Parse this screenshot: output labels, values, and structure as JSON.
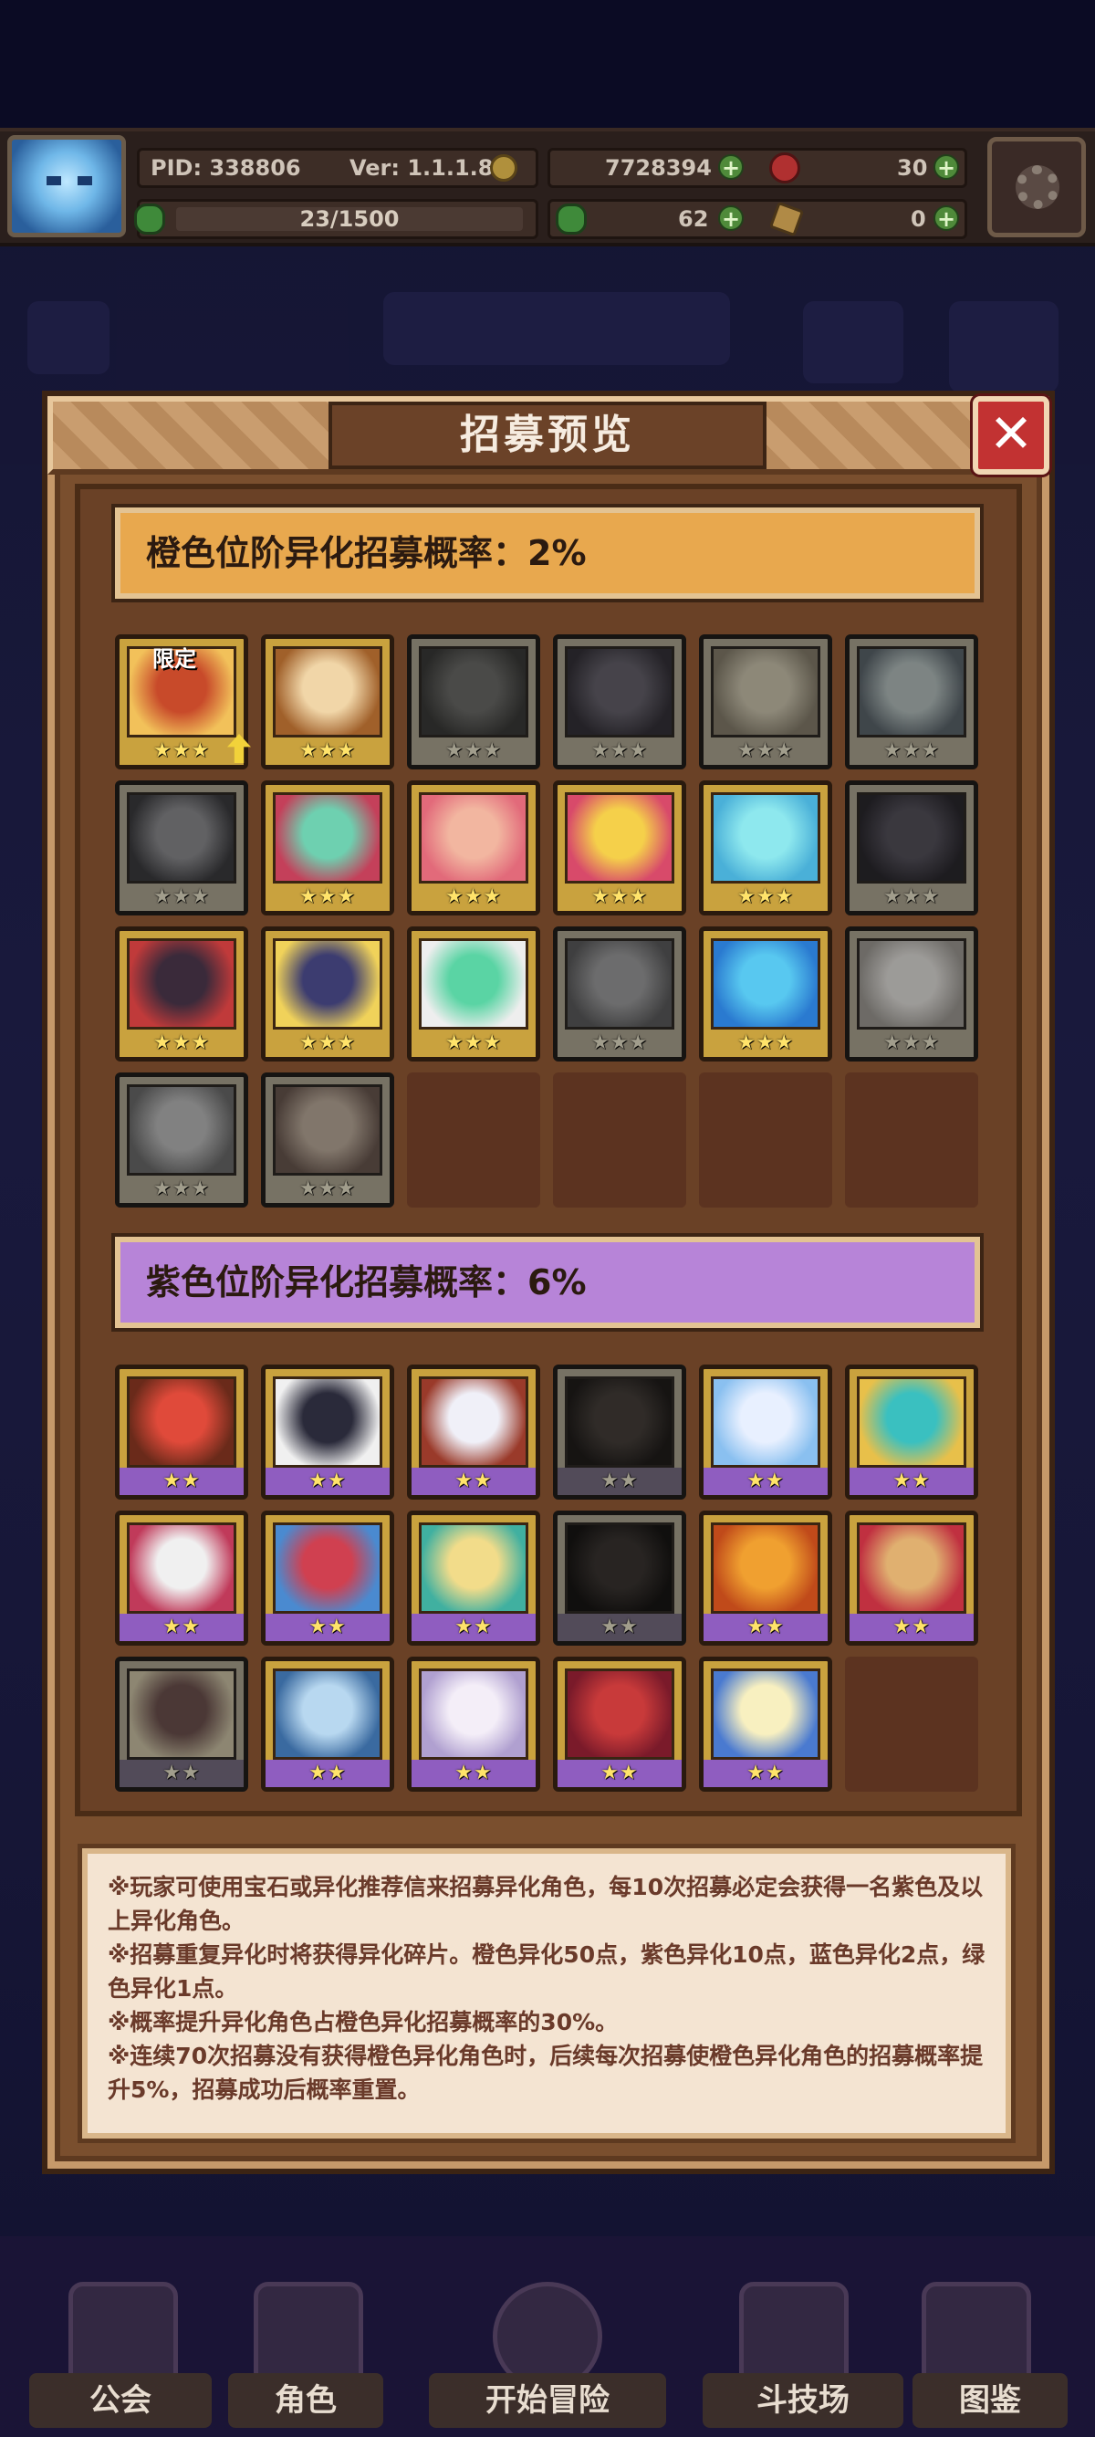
{
  "status": {
    "pid_label": "PID: 338806",
    "version_label": "Ver: 1.1.1.8",
    "gold": "7728394",
    "gems": "30",
    "exp": "23/1500",
    "clover": "62",
    "keys": "0"
  },
  "modal": {
    "title": "招募预览",
    "close_icon": "close-icon",
    "orange_section": {
      "rate_label": "橙色位阶异化招募概率：2%",
      "limited_tag": "限定",
      "cards": [
        {
          "stars": "★★★",
          "dim": false,
          "limited": true,
          "boost": true,
          "colors": [
            "#c84a2a",
            "#f2c15a"
          ]
        },
        {
          "stars": "★★★",
          "dim": false,
          "colors": [
            "#f1d6a8",
            "#a0602a"
          ]
        },
        {
          "stars": "★★★",
          "dim": true,
          "colors": [
            "#6a6a5c",
            "#3a3a30"
          ]
        },
        {
          "stars": "★★★",
          "dim": true,
          "colors": [
            "#6c5a8a",
            "#3b2c50"
          ]
        },
        {
          "stars": "★★★",
          "dim": true,
          "colors": [
            "#e6c254",
            "#a07a22"
          ]
        },
        {
          "stars": "★★★",
          "dim": true,
          "colors": [
            "#8fc7c0",
            "#3a6a8a"
          ]
        },
        {
          "stars": "★★★",
          "dim": true,
          "colors": [
            "#8a8a9a",
            "#3a3a4a"
          ]
        },
        {
          "stars": "★★★",
          "dim": false,
          "colors": [
            "#6ed0b0",
            "#c4405a"
          ]
        },
        {
          "stars": "★★★",
          "dim": false,
          "colors": [
            "#f2b6a0",
            "#e26a7a"
          ]
        },
        {
          "stars": "★★★",
          "dim": false,
          "colors": [
            "#f5d04a",
            "#d84a6a"
          ]
        },
        {
          "stars": "★★★",
          "dim": false,
          "colors": [
            "#8ee8ee",
            "#4ab0d8"
          ]
        },
        {
          "stars": "★★★",
          "dim": true,
          "colors": [
            "#5a4a7a",
            "#2e2440"
          ]
        },
        {
          "stars": "★★★",
          "dim": false,
          "colors": [
            "#3a2a3a",
            "#c03a3a"
          ]
        },
        {
          "stars": "★★★",
          "dim": false,
          "colors": [
            "#3c3c70",
            "#f0d25a"
          ]
        },
        {
          "stars": "★★★",
          "dim": false,
          "colors": [
            "#5ad4a4",
            "#eeeeee"
          ]
        },
        {
          "stars": "★★★",
          "dim": true,
          "colors": [
            "#9a9aa0",
            "#5a5a60"
          ]
        },
        {
          "stars": "★★★",
          "dim": false,
          "colors": [
            "#58c8f0",
            "#2a7ad0"
          ]
        },
        {
          "stars": "★★★",
          "dim": true,
          "colors": [
            "#e8dcc8",
            "#a8967a"
          ]
        },
        {
          "stars": "★★★",
          "dim": true,
          "colors": [
            "#b8b8b8",
            "#6a6a6a"
          ]
        },
        {
          "stars": "★★★",
          "dim": true,
          "colors": [
            "#f0a050",
            "#a04a20"
          ]
        }
      ],
      "empty_slots": 4
    },
    "purple_section": {
      "rate_label": "紫色位阶异化招募概率：6%",
      "cards": [
        {
          "stars": "★★",
          "dim": false,
          "colors": [
            "#e04a3a",
            "#6a2a1a"
          ]
        },
        {
          "stars": "★★",
          "dim": false,
          "colors": [
            "#2a2a3a",
            "#f0f0f0"
          ]
        },
        {
          "stars": "★★",
          "dim": false,
          "colors": [
            "#f0f0f8",
            "#9a3a2a"
          ]
        },
        {
          "stars": "★★",
          "dim": true,
          "colors": [
            "#5a3a22",
            "#2a1a10"
          ]
        },
        {
          "stars": "★★",
          "dim": false,
          "colors": [
            "#e8f0ff",
            "#8ac0f0"
          ]
        },
        {
          "stars": "★★",
          "dim": false,
          "colors": [
            "#3ac0c0",
            "#e8c04a"
          ]
        },
        {
          "stars": "★★",
          "dim": false,
          "colors": [
            "#f0f0f0",
            "#c03a5a"
          ]
        },
        {
          "stars": "★★",
          "dim": false,
          "colors": [
            "#d04050",
            "#4a8ad0"
          ]
        },
        {
          "stars": "★★",
          "dim": false,
          "colors": [
            "#f2dc8a",
            "#40b0a0"
          ]
        },
        {
          "stars": "★★",
          "dim": true,
          "colors": [
            "#4a3020",
            "#1e140c"
          ]
        },
        {
          "stars": "★★",
          "dim": false,
          "colors": [
            "#f0a030",
            "#c04a1a"
          ]
        },
        {
          "stars": "★★",
          "dim": false,
          "colors": [
            "#e0b070",
            "#c03040"
          ]
        },
        {
          "stars": "★★",
          "dim": true,
          "colors": [
            "#c03a2a",
            "#f0c030"
          ]
        },
        {
          "stars": "★★",
          "dim": false,
          "colors": [
            "#b8d8f0",
            "#3a6aa0"
          ]
        },
        {
          "stars": "★★",
          "dim": false,
          "colors": [
            "#f4eef8",
            "#b0a0d0"
          ]
        },
        {
          "stars": "★★",
          "dim": false,
          "colors": [
            "#c83a3a",
            "#7a1a2a"
          ]
        },
        {
          "stars": "★★",
          "dim": false,
          "colors": [
            "#f8f0c0",
            "#4a7ad0"
          ]
        }
      ],
      "empty_slots": 1
    },
    "notes": [
      "※玩家可使用宝石或异化推荐信来招募异化角色，每10次招募必定会获得一名紫色及以上异化角色。",
      "※招募重复异化时将获得异化碎片。橙色异化50点，紫色异化10点，蓝色异化2点，绿色异化1点。",
      "※概率提升异化角色占橙色异化招募概率的30%。",
      "※连续70次招募没有获得橙色异化角色时，后续每次招募使橙色异化角色的招募概率提升5%，招募成功后概率重置。"
    ]
  },
  "nav": {
    "items": [
      {
        "label": "公会",
        "icon": "guild-icon"
      },
      {
        "label": "角色",
        "icon": "character-icon"
      },
      {
        "label": "开始冒险",
        "icon": "magnifier-icon"
      },
      {
        "label": "斗技场",
        "icon": "swords-icon"
      },
      {
        "label": "图鉴",
        "icon": "book-icon"
      }
    ]
  }
}
